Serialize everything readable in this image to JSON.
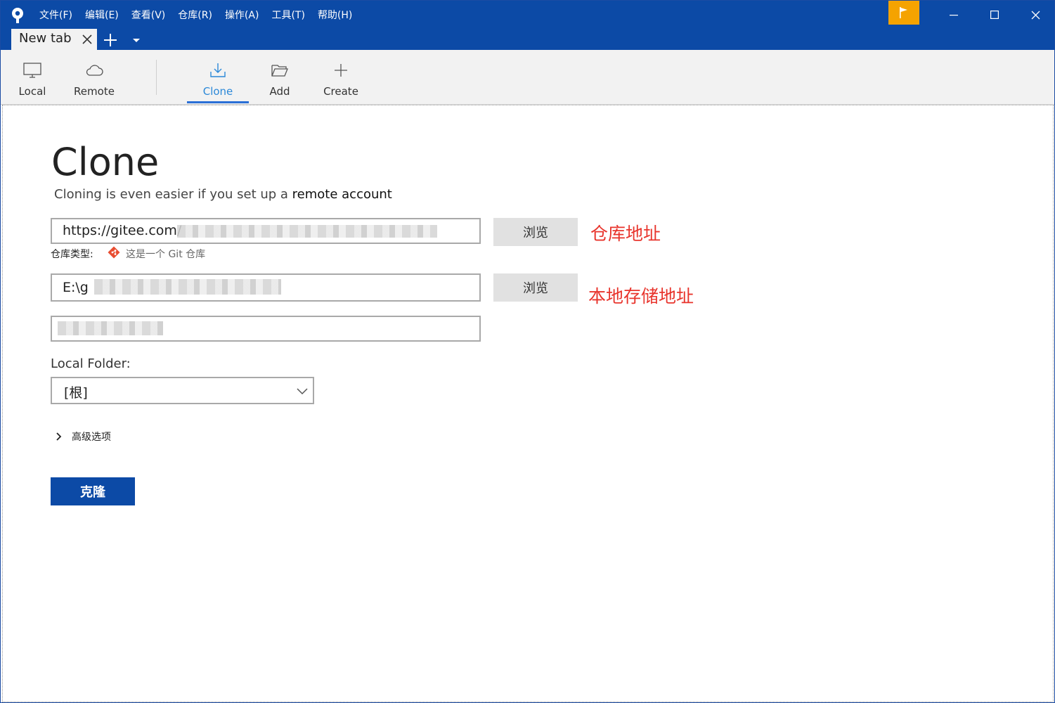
{
  "menu": {
    "items": [
      "文件(F)",
      "编辑(E)",
      "查看(V)",
      "仓库(R)",
      "操作(A)",
      "工具(T)",
      "帮助(H)"
    ]
  },
  "tabs": {
    "active_title": "New tab"
  },
  "toolbar": {
    "local": "Local",
    "remote": "Remote",
    "clone": "Clone",
    "add": "Add",
    "create": "Create",
    "active": "Clone"
  },
  "clone": {
    "title": "Clone",
    "subtitle_prefix": "Cloning is even easier if you set up a ",
    "subtitle_link": "remote account",
    "url_value": "https://gitee.com/",
    "repo_type_label": "仓库类型:",
    "repo_type_value": "这是一个 Git 仓库",
    "path_value": "E:\\g",
    "browse_label": "浏览",
    "local_folder_label": "Local Folder:",
    "local_folder_value": "[根]",
    "advanced_label": "高级选项",
    "clone_button": "克隆"
  },
  "annotations": {
    "url_note": "仓库地址",
    "path_note": "本地存储地址"
  },
  "colors": {
    "titlebar": "#0c4aa6",
    "accent_tab": "#2b88d8",
    "flag": "#f5a300",
    "annotation": "#e8342c",
    "git_icon": "#e84d31"
  }
}
